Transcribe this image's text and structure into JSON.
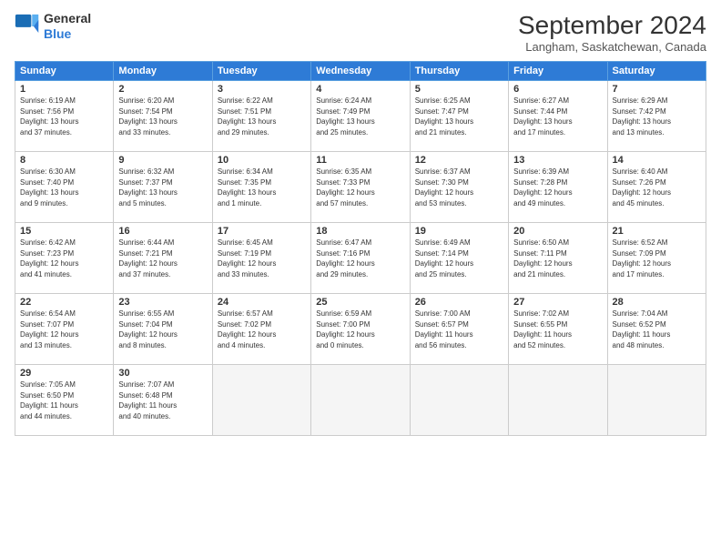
{
  "header": {
    "logo_line1": "General",
    "logo_line2": "Blue",
    "month_year": "September 2024",
    "location": "Langham, Saskatchewan, Canada"
  },
  "weekdays": [
    "Sunday",
    "Monday",
    "Tuesday",
    "Wednesday",
    "Thursday",
    "Friday",
    "Saturday"
  ],
  "weeks": [
    [
      {
        "day": "1",
        "info": "Sunrise: 6:19 AM\nSunset: 7:56 PM\nDaylight: 13 hours\nand 37 minutes."
      },
      {
        "day": "2",
        "info": "Sunrise: 6:20 AM\nSunset: 7:54 PM\nDaylight: 13 hours\nand 33 minutes."
      },
      {
        "day": "3",
        "info": "Sunrise: 6:22 AM\nSunset: 7:51 PM\nDaylight: 13 hours\nand 29 minutes."
      },
      {
        "day": "4",
        "info": "Sunrise: 6:24 AM\nSunset: 7:49 PM\nDaylight: 13 hours\nand 25 minutes."
      },
      {
        "day": "5",
        "info": "Sunrise: 6:25 AM\nSunset: 7:47 PM\nDaylight: 13 hours\nand 21 minutes."
      },
      {
        "day": "6",
        "info": "Sunrise: 6:27 AM\nSunset: 7:44 PM\nDaylight: 13 hours\nand 17 minutes."
      },
      {
        "day": "7",
        "info": "Sunrise: 6:29 AM\nSunset: 7:42 PM\nDaylight: 13 hours\nand 13 minutes."
      }
    ],
    [
      {
        "day": "8",
        "info": "Sunrise: 6:30 AM\nSunset: 7:40 PM\nDaylight: 13 hours\nand 9 minutes."
      },
      {
        "day": "9",
        "info": "Sunrise: 6:32 AM\nSunset: 7:37 PM\nDaylight: 13 hours\nand 5 minutes."
      },
      {
        "day": "10",
        "info": "Sunrise: 6:34 AM\nSunset: 7:35 PM\nDaylight: 13 hours\nand 1 minute."
      },
      {
        "day": "11",
        "info": "Sunrise: 6:35 AM\nSunset: 7:33 PM\nDaylight: 12 hours\nand 57 minutes."
      },
      {
        "day": "12",
        "info": "Sunrise: 6:37 AM\nSunset: 7:30 PM\nDaylight: 12 hours\nand 53 minutes."
      },
      {
        "day": "13",
        "info": "Sunrise: 6:39 AM\nSunset: 7:28 PM\nDaylight: 12 hours\nand 49 minutes."
      },
      {
        "day": "14",
        "info": "Sunrise: 6:40 AM\nSunset: 7:26 PM\nDaylight: 12 hours\nand 45 minutes."
      }
    ],
    [
      {
        "day": "15",
        "info": "Sunrise: 6:42 AM\nSunset: 7:23 PM\nDaylight: 12 hours\nand 41 minutes."
      },
      {
        "day": "16",
        "info": "Sunrise: 6:44 AM\nSunset: 7:21 PM\nDaylight: 12 hours\nand 37 minutes."
      },
      {
        "day": "17",
        "info": "Sunrise: 6:45 AM\nSunset: 7:19 PM\nDaylight: 12 hours\nand 33 minutes."
      },
      {
        "day": "18",
        "info": "Sunrise: 6:47 AM\nSunset: 7:16 PM\nDaylight: 12 hours\nand 29 minutes."
      },
      {
        "day": "19",
        "info": "Sunrise: 6:49 AM\nSunset: 7:14 PM\nDaylight: 12 hours\nand 25 minutes."
      },
      {
        "day": "20",
        "info": "Sunrise: 6:50 AM\nSunset: 7:11 PM\nDaylight: 12 hours\nand 21 minutes."
      },
      {
        "day": "21",
        "info": "Sunrise: 6:52 AM\nSunset: 7:09 PM\nDaylight: 12 hours\nand 17 minutes."
      }
    ],
    [
      {
        "day": "22",
        "info": "Sunrise: 6:54 AM\nSunset: 7:07 PM\nDaylight: 12 hours\nand 13 minutes."
      },
      {
        "day": "23",
        "info": "Sunrise: 6:55 AM\nSunset: 7:04 PM\nDaylight: 12 hours\nand 8 minutes."
      },
      {
        "day": "24",
        "info": "Sunrise: 6:57 AM\nSunset: 7:02 PM\nDaylight: 12 hours\nand 4 minutes."
      },
      {
        "day": "25",
        "info": "Sunrise: 6:59 AM\nSunset: 7:00 PM\nDaylight: 12 hours\nand 0 minutes."
      },
      {
        "day": "26",
        "info": "Sunrise: 7:00 AM\nSunset: 6:57 PM\nDaylight: 11 hours\nand 56 minutes."
      },
      {
        "day": "27",
        "info": "Sunrise: 7:02 AM\nSunset: 6:55 PM\nDaylight: 11 hours\nand 52 minutes."
      },
      {
        "day": "28",
        "info": "Sunrise: 7:04 AM\nSunset: 6:52 PM\nDaylight: 11 hours\nand 48 minutes."
      }
    ],
    [
      {
        "day": "29",
        "info": "Sunrise: 7:05 AM\nSunset: 6:50 PM\nDaylight: 11 hours\nand 44 minutes."
      },
      {
        "day": "30",
        "info": "Sunrise: 7:07 AM\nSunset: 6:48 PM\nDaylight: 11 hours\nand 40 minutes."
      },
      {
        "day": "",
        "info": ""
      },
      {
        "day": "",
        "info": ""
      },
      {
        "day": "",
        "info": ""
      },
      {
        "day": "",
        "info": ""
      },
      {
        "day": "",
        "info": ""
      }
    ]
  ]
}
